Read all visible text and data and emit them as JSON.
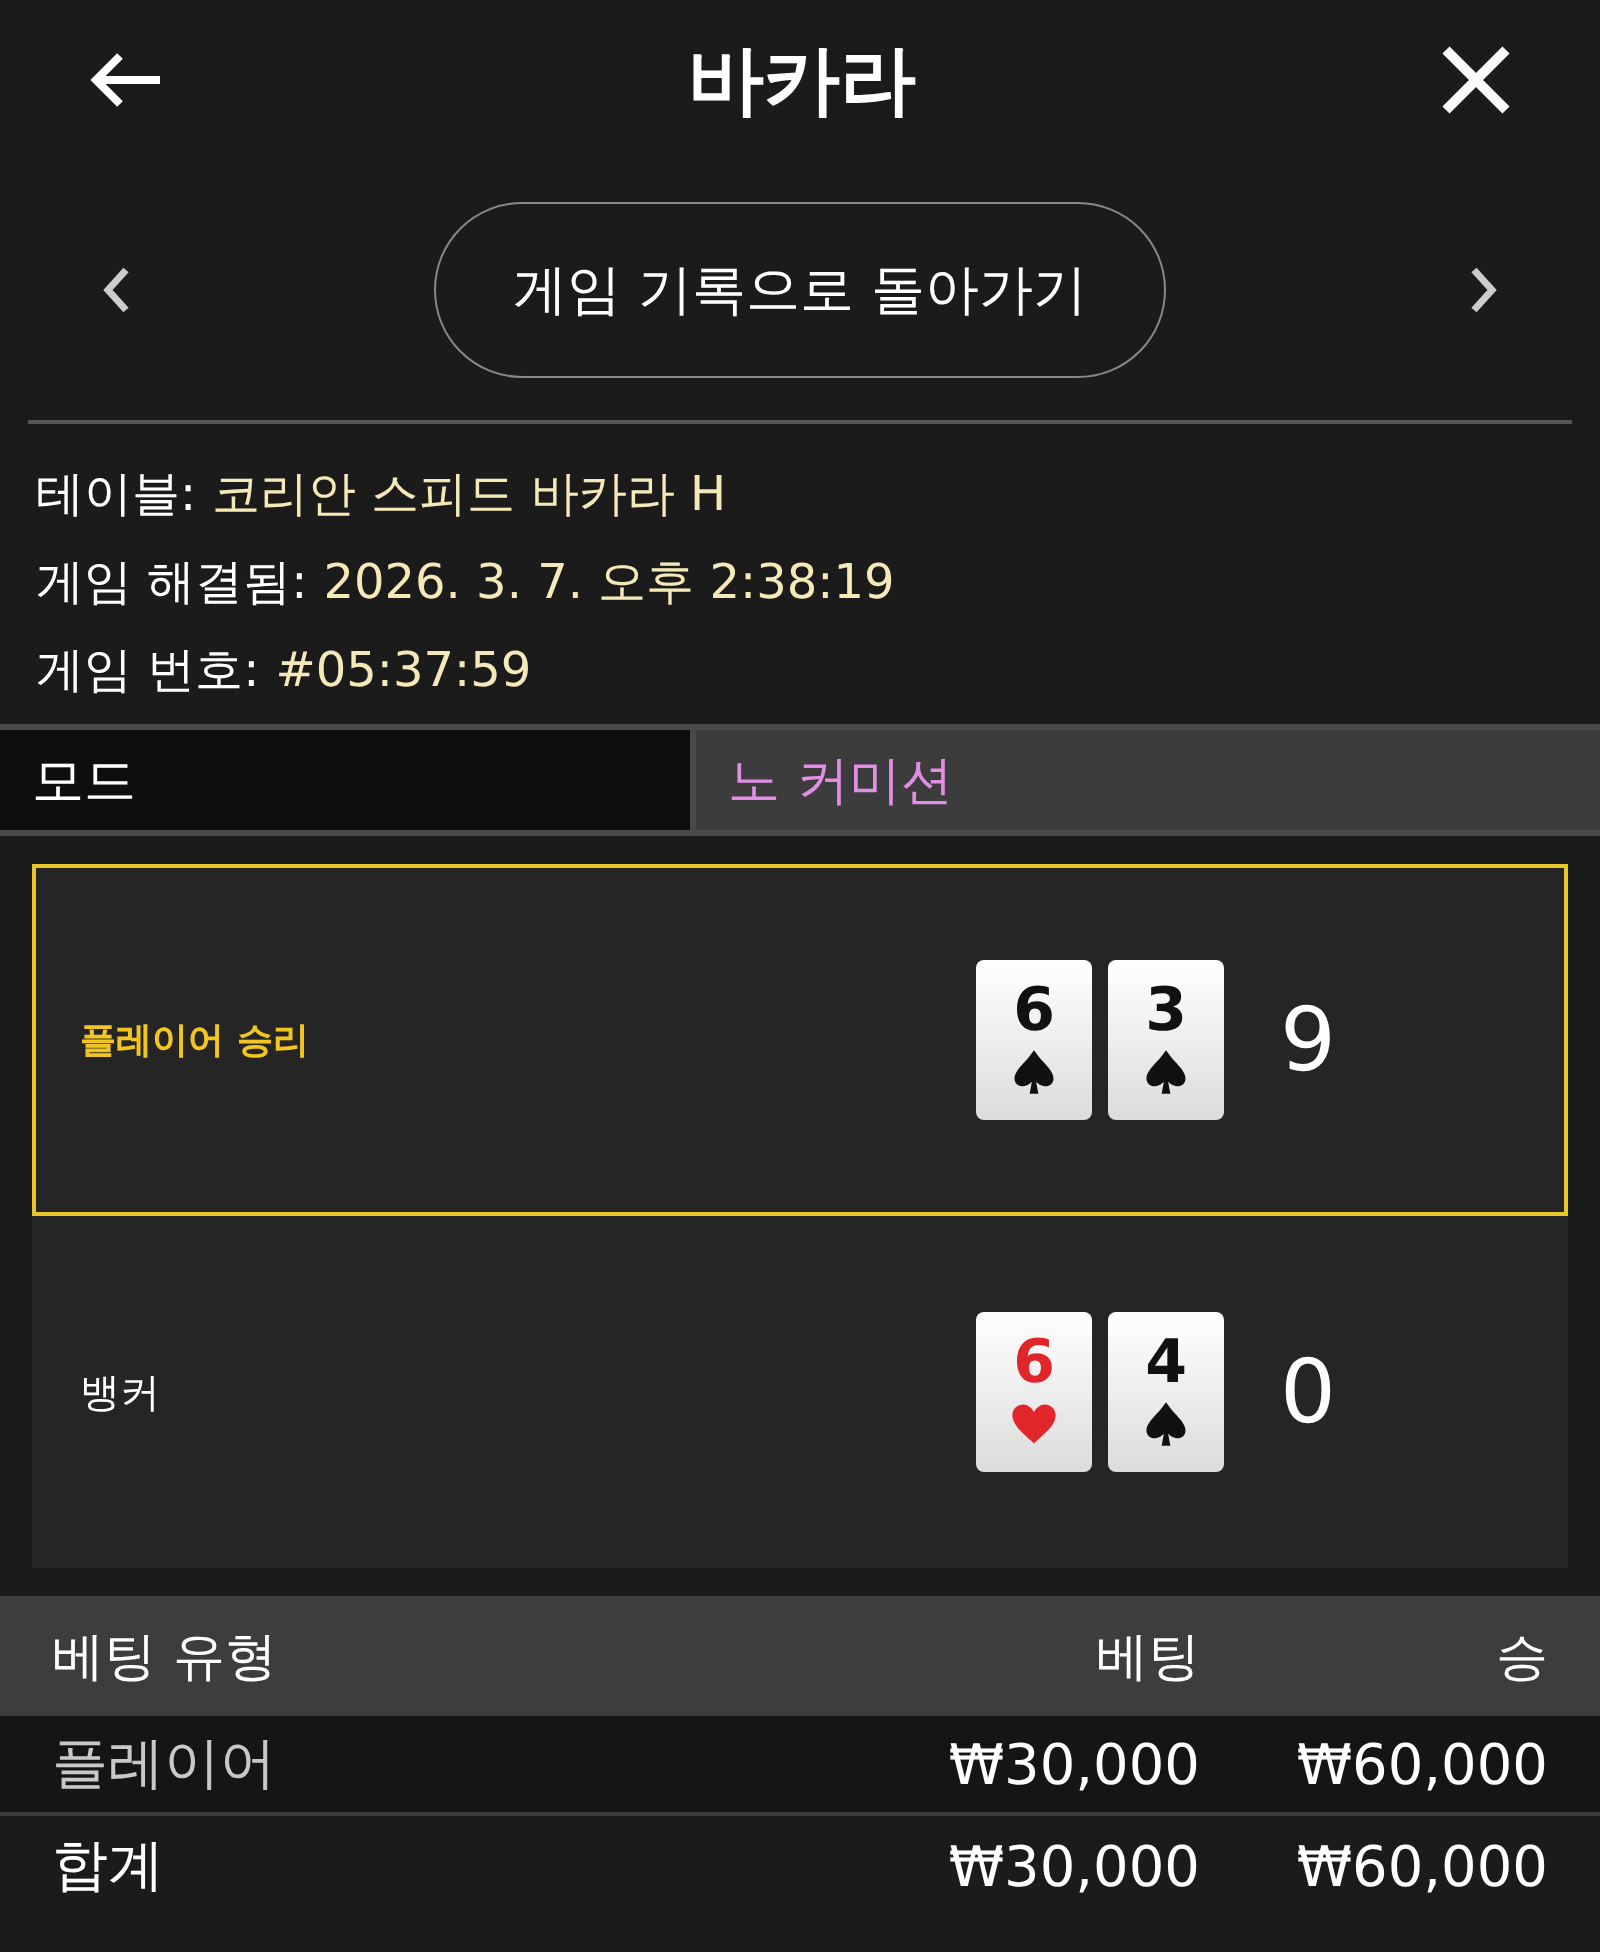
{
  "header": {
    "title": "바카라"
  },
  "nav": {
    "button": "게임 기록으로 돌아가기"
  },
  "info": [
    {
      "label": "테이블:",
      "value": "코리안 스피드 바카라 H"
    },
    {
      "label": "게임 해결됨:",
      "value": "2026. 3. 7. 오후 2:38:19"
    },
    {
      "label": "게임 번호:",
      "value": "#05:37:59"
    }
  ],
  "mode": {
    "label": "모드",
    "value": "노 커미션"
  },
  "hands": [
    {
      "label": "플레이어 승리",
      "winner": true,
      "cards": [
        {
          "rank": "6",
          "kind": "spade"
        },
        {
          "rank": "3",
          "kind": "spade"
        }
      ],
      "score": "9"
    },
    {
      "label": "뱅커",
      "winner": false,
      "cards": [
        {
          "rank": "6",
          "kind": "heart"
        },
        {
          "rank": "4",
          "kind": "spade"
        }
      ],
      "score": "0"
    }
  ],
  "bets": {
    "columns": [
      "베팅 유형",
      "베팅",
      "승"
    ],
    "rows": [
      {
        "type": "플레이어",
        "bet": "₩30,000",
        "win": "₩60,000"
      }
    ],
    "total": {
      "type": "합계",
      "bet": "₩30,000",
      "win": "₩60,000"
    }
  }
}
